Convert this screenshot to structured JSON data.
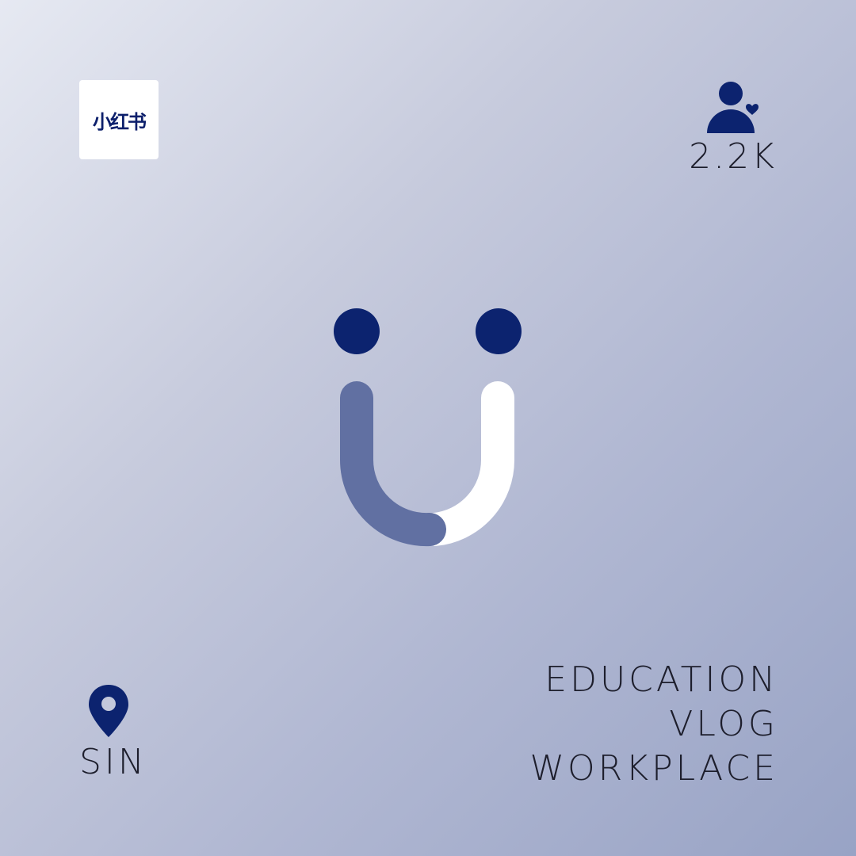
{
  "brand": {
    "logo_text": "小红书",
    "logo_bg": "#ffffff",
    "logo_color": "#0c1f6b"
  },
  "profile": {
    "followers_icon": "person-heart-icon",
    "followers_count": "2.2K"
  },
  "mascot": {
    "icon": "smile-face-icon",
    "eye_color": "#0c236f",
    "left_arc_color": "#6170a2",
    "right_arc_color": "#ffffff"
  },
  "location": {
    "icon": "map-pin-icon",
    "label": "SIN"
  },
  "tags": [
    "EDUCATION",
    "VLOG",
    "WORKPLACE"
  ],
  "theme": {
    "accent": "#0c236f",
    "text": "#1d1e2c"
  }
}
